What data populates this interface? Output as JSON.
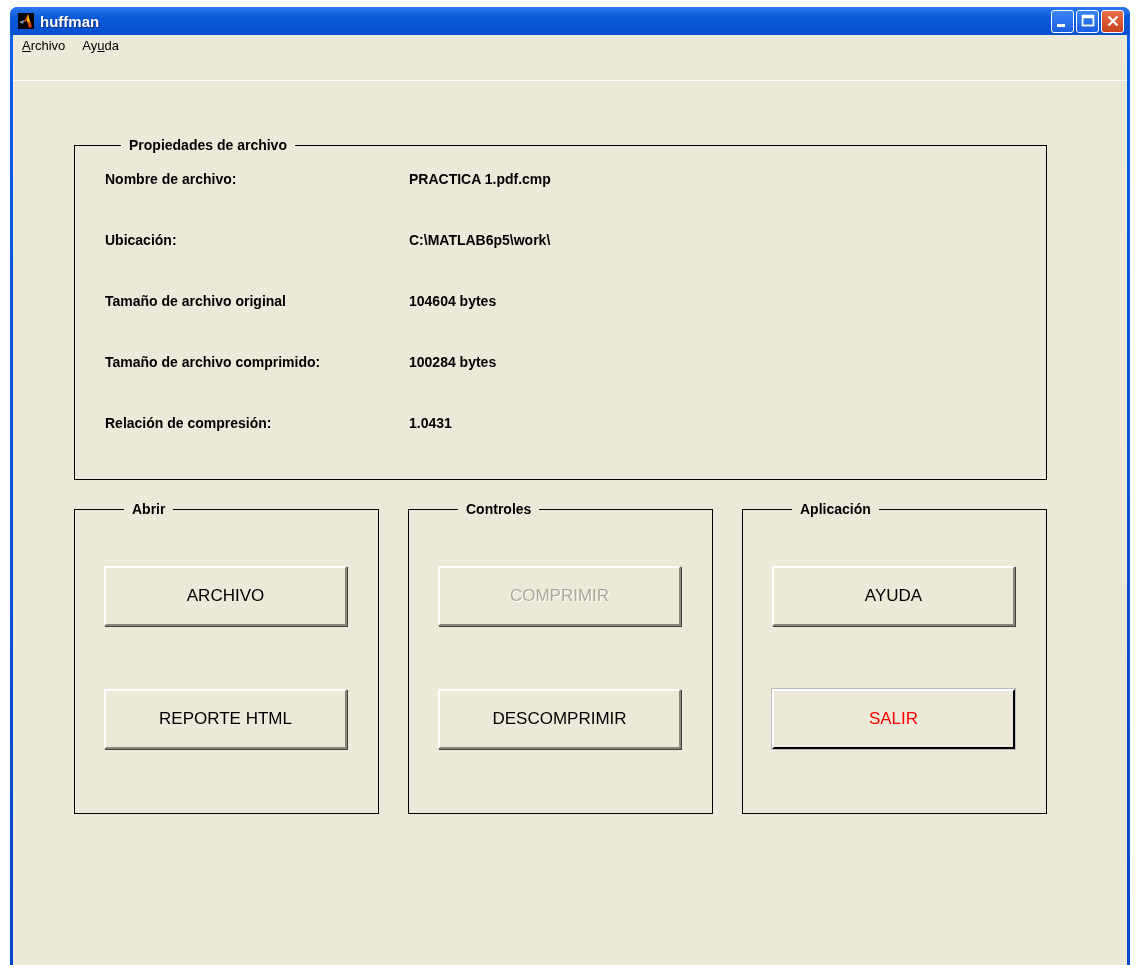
{
  "window": {
    "title": "huffman"
  },
  "menu": [
    {
      "key": "A",
      "after": "rchivo"
    },
    {
      "before": "Ay",
      "key": "u",
      "after": "da"
    }
  ],
  "properties": {
    "title": "Propiedades de archivo",
    "rows": [
      {
        "label": "Nombre de archivo:",
        "value": "PRACTICA 1.pdf.cmp"
      },
      {
        "label": "Ubicación:",
        "value": "C:\\MATLAB6p5\\work\\"
      },
      {
        "label": "Tamaño de archivo original",
        "value": "104604 bytes"
      },
      {
        "label": "Tamaño de archivo comprimido:",
        "value": "100284 bytes"
      },
      {
        "label": "Relación de compresión:",
        "value": "1.0431"
      }
    ]
  },
  "groups": [
    {
      "title": "Abrir",
      "buttons": [
        {
          "label": "ARCHIVO",
          "disabled": false,
          "default": false,
          "color": "#000000"
        },
        {
          "label": "REPORTE HTML",
          "disabled": false,
          "default": false,
          "color": "#000000"
        }
      ]
    },
    {
      "title": "Controles",
      "buttons": [
        {
          "label": "COMPRIMIR",
          "disabled": true,
          "default": false
        },
        {
          "label": "DESCOMPRIMIR",
          "disabled": false,
          "default": false,
          "color": "#000000"
        }
      ]
    },
    {
      "title": "Aplicación",
      "buttons": [
        {
          "label": "AYUDA",
          "disabled": false,
          "default": false,
          "color": "#000000"
        },
        {
          "label": "SALIR",
          "disabled": false,
          "default": true,
          "color": "#ff0000"
        }
      ]
    }
  ]
}
